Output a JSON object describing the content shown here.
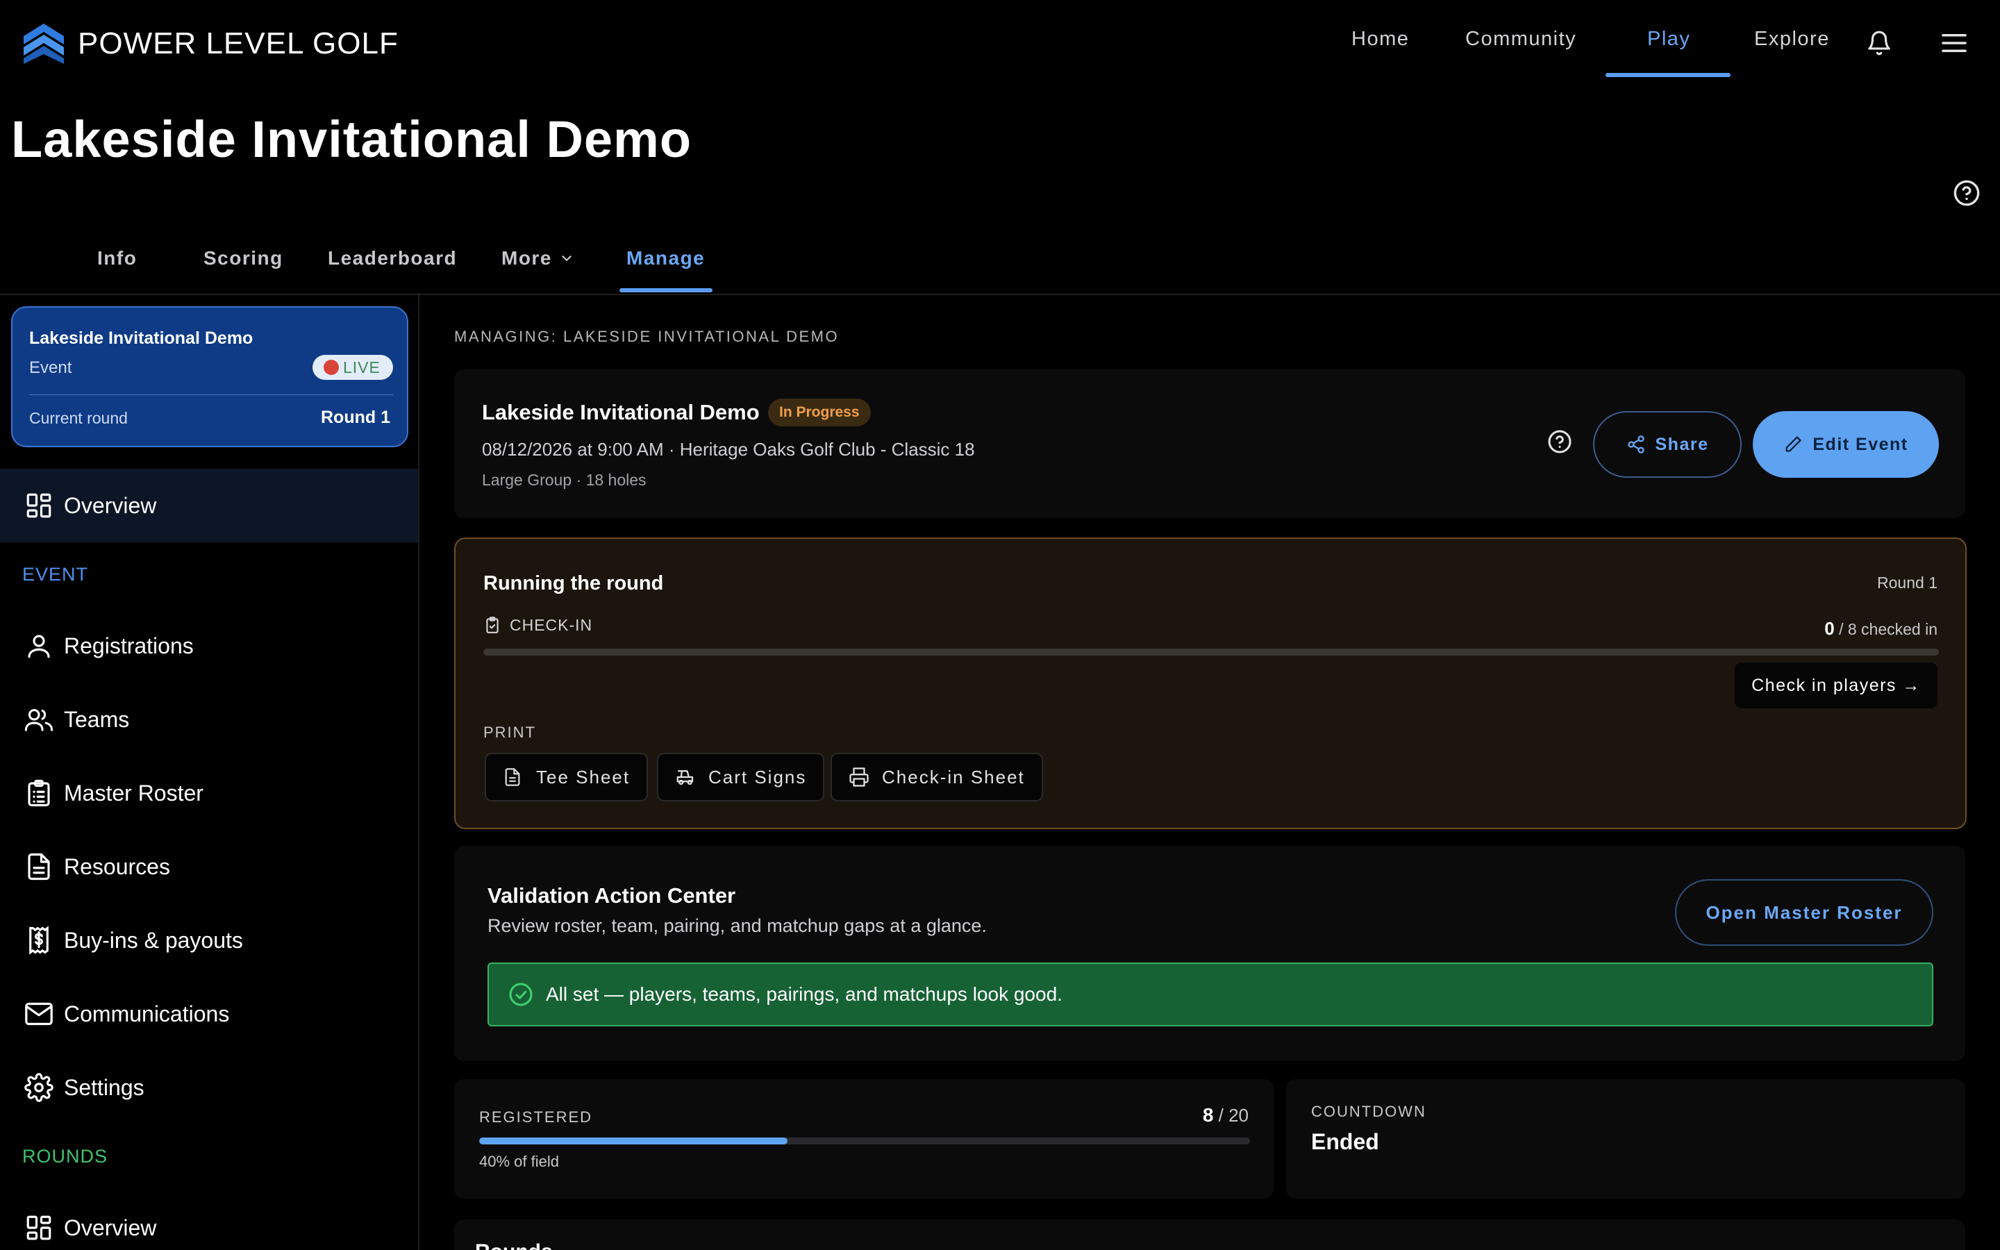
{
  "brand": {
    "name": "POWER LEVEL GOLF",
    "logo_icon": "chevron-stack-logo"
  },
  "nav": {
    "links": [
      {
        "label": "Home"
      },
      {
        "label": "Community"
      },
      {
        "label": "Play"
      },
      {
        "label": "Explore"
      }
    ],
    "active": "Play",
    "icons": [
      "bell-icon",
      "menu-icon"
    ]
  },
  "page": {
    "title": "Lakeside Invitational Demo"
  },
  "tabs": [
    {
      "label": "Info"
    },
    {
      "label": "Scoring"
    },
    {
      "label": "Leaderboard"
    },
    {
      "label": "More"
    },
    {
      "label": "Manage"
    }
  ],
  "sidebar": {
    "event_card": {
      "title": "Lakeside Invitational Demo",
      "type": "Event",
      "status": "LIVE",
      "round_label": "Current round",
      "round_value": "Round 1"
    },
    "overview_label": "Overview",
    "event_section": "EVENT",
    "event_items": [
      {
        "label": "Registrations",
        "icon": "person-icon"
      },
      {
        "label": "Teams",
        "icon": "people-icon"
      },
      {
        "label": "Master Roster",
        "icon": "clipboard-list-icon"
      },
      {
        "label": "Resources",
        "icon": "document-icon"
      },
      {
        "label": "Buy-ins & payouts",
        "icon": "dollar-receipt-icon"
      },
      {
        "label": "Communications",
        "icon": "mail-icon"
      },
      {
        "label": "Settings",
        "icon": "gear-icon"
      }
    ],
    "rounds_section": "ROUNDS",
    "rounds_overview_label": "Overview",
    "colors": {
      "event_section": "#4f8fef",
      "rounds_section": "#3ec46d",
      "card_bg": "#0f3b86"
    }
  },
  "main": {
    "managing_label": "MANAGING: LAKESIDE INVITATIONAL DEMO",
    "event": {
      "name": "Lakeside Invitational Demo",
      "status": "In Progress",
      "meta": "08/12/2026 at 9:00 AM · Heritage Oaks Golf Club - Classic 18",
      "format": "Large Group · 18 holes",
      "share_label": "Share",
      "edit_label": "Edit Event"
    },
    "running": {
      "title": "Running the round",
      "round": "Round 1",
      "checkin_label": "CHECK-IN",
      "checked_in": "0",
      "checked_total": " / 8 checked in",
      "checkin_button": "Check in players →",
      "print_label": "PRINT",
      "print_buttons": [
        {
          "label": "Tee Sheet",
          "icon": "document-icon"
        },
        {
          "label": "Cart Signs",
          "icon": "golf-cart-icon"
        },
        {
          "label": "Check-in Sheet",
          "icon": "printer-icon"
        }
      ]
    },
    "validation": {
      "title": "Validation Action Center",
      "subtitle": "Review roster, team, pairing, and matchup gaps at a glance.",
      "button": "Open Master Roster",
      "status_message": "All set — players, teams, pairings, and matchups look good."
    },
    "registered": {
      "label": "REGISTERED",
      "count": "8",
      "capacity": " / 20",
      "fill_fraction": 0.4,
      "note": "40% of field"
    },
    "countdown": {
      "label": "COUNTDOWN",
      "value": "Ended"
    },
    "next_section_title": "Rounds"
  },
  "colors": {
    "accent": "#5ea3f2",
    "warning_card_border": "#6f4e22",
    "success_bg": "#176235",
    "success_border": "#35b05c",
    "status_pill_text": "#f0a04b"
  }
}
